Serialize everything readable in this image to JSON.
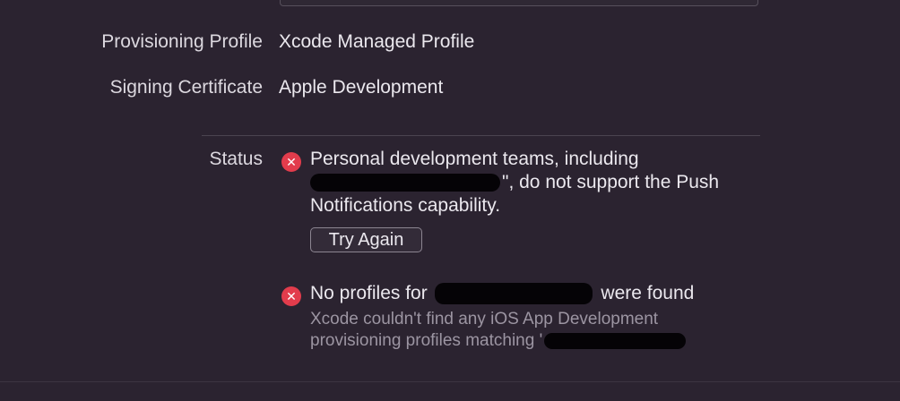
{
  "signing": {
    "provisioning_profile_label": "Provisioning Profile",
    "provisioning_profile_value": "Xcode Managed Profile",
    "signing_certificate_label": "Signing Certificate",
    "signing_certificate_value": "Apple Development"
  },
  "status": {
    "label": "Status",
    "errors": [
      {
        "icon": "error-circle-icon",
        "line1": "Personal development teams, including",
        "line2_suffix": "\", do not support the Push",
        "line3": "Notifications capability.",
        "button_label": "Try Again"
      },
      {
        "icon": "error-circle-icon",
        "title_prefix": "No profiles for",
        "title_suffix": "were found",
        "detail_line1": "Xcode couldn't find any iOS App Development",
        "detail_line2_prefix": "provisioning profiles matching '"
      }
    ]
  },
  "colors": {
    "background": "#2b2330",
    "error_icon": "#e23c4c",
    "secondary_text": "#9c95a2"
  }
}
